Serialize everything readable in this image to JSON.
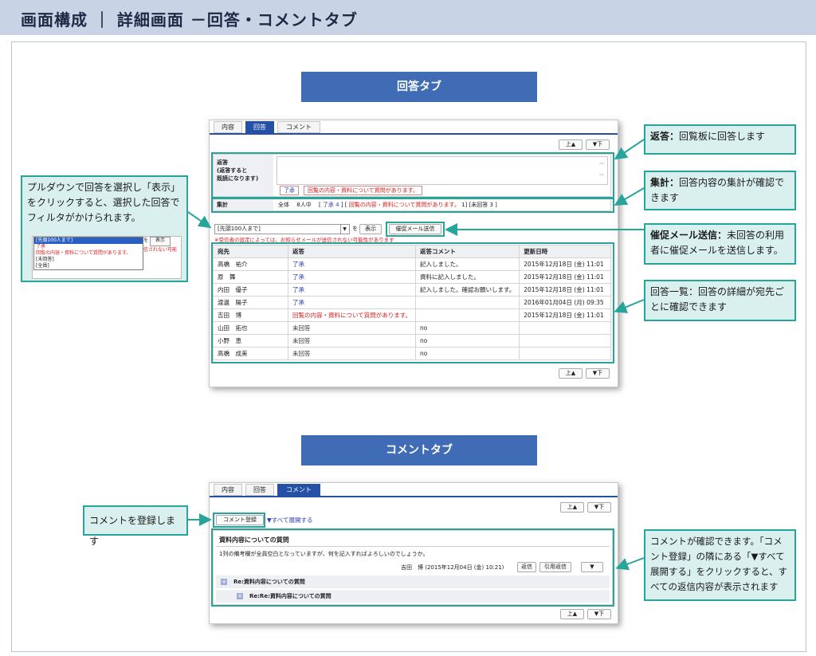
{
  "header": {
    "title": "画面構成 ｜ 詳細画面 －回答・コメントタブ"
  },
  "banners": {
    "answer": "回答タブ",
    "comment": "コメントタブ"
  },
  "answer_tab": {
    "tabs": [
      "内容",
      "回答",
      "コメント"
    ],
    "active_tab": "回答",
    "up_btn": "上▲",
    "down_btn": "▼下",
    "reply_label": "返答\n(返答すると\n既読になります)",
    "reply_options": [
      "了承",
      "回覧の内容・資料について質問があります。"
    ],
    "summary_label": "集計",
    "summary_scope": "全体",
    "summary_count": "8人中",
    "summary_prefix": "[",
    "summary_ack": "了承 4",
    "summary_mid": "] [",
    "summary_question": "回覧の内容・資料について質問があります。",
    "summary_question_count": "1] [未回答 3 ]",
    "filter_select": "[先頭100人まで]",
    "filter_wo": "を",
    "show_btn": "表示",
    "reminder_btn": "催促メール送信",
    "notice": "※受信者の設定によっては、お知らせメールが送信されない可能性があります",
    "columns": [
      "宛先",
      "返答",
      "返答コメント",
      "更新日時"
    ],
    "rows": [
      {
        "to": "高橋　祐介",
        "reply": "了承",
        "color": "#2a3fc0",
        "comment": "記入しました。",
        "date": "2015年12月18日 (金) 11:01"
      },
      {
        "to": "原　舞",
        "reply": "了承",
        "color": "#2a3fc0",
        "comment": "資料に記入しました。",
        "date": "2015年12月18日 (金) 11:01"
      },
      {
        "to": "内田　優子",
        "reply": "了承",
        "color": "#2a3fc0",
        "comment": "記入しました。確認お願いします。",
        "date": "2015年12月18日 (金) 11:01"
      },
      {
        "to": "渡邊　陽子",
        "reply": "了承",
        "color": "#2a3fc0",
        "comment": "",
        "date": "2016年01月04日 (月) 09:35"
      },
      {
        "to": "吉田　博",
        "reply": "回覧の内容・資料について質問があります。",
        "color": "#d62020",
        "comment": "",
        "date": "2015年12月18日 (金) 11:01"
      },
      {
        "to": "山田　拓也",
        "reply": "未回答",
        "color": "#333333",
        "comment": "no",
        "date": ""
      },
      {
        "to": "小野　恵",
        "reply": "未回答",
        "color": "#333333",
        "comment": "no",
        "date": ""
      },
      {
        "to": "高橋　成美",
        "reply": "未回答",
        "color": "#333333",
        "comment": "no",
        "date": ""
      }
    ]
  },
  "dropdown_example": {
    "options": [
      "[先頭100人まで]",
      "了承",
      "回覧の内容・資料について質問があります。",
      "[未回答]",
      "[全員]"
    ],
    "side_btn": "表示",
    "side_wo": "を",
    "side_red": "信されない可能"
  },
  "callouts": {
    "filter": "プルダウンで回答を選択し「表示」をクリックすると、選択した回答でフィルタがかけられます。",
    "reply_title": "返答：",
    "reply_text": "回覧板に回答します",
    "summary_title": "集計：",
    "summary_text": "回答内容の集計が確認できます",
    "reminder_title": "催促メール送信：",
    "reminder_text": "未回答の利用者に催促メールを送信します。",
    "list_text": "回答一覧：回答の詳細が宛先ごとに確認できます",
    "register_text": "コメントを登録します",
    "comment_text": "コメントが確認できます。「コメント登録」の隣にある「▼すべて展開する」をクリックすると、すべての返信内容が表示されます"
  },
  "comment_tab": {
    "tabs": [
      "内容",
      "回答",
      "コメント"
    ],
    "active_tab": "コメント",
    "up_btn": "上▲",
    "down_btn": "▼下",
    "register_btn": "コメント登録",
    "expand_link": "▼すべて展開する",
    "thread_title": "資料内容についての質問",
    "thread_body": "1列の備考欄が全員空白となっていますが、何を記入すればよろしいのでしょうか。",
    "thread_meta": "吉田　博 (2015年12月04日 (金) 10:21)",
    "reply_btn": "返信",
    "quote_btn": "引用返信",
    "menu_btn": "▼",
    "reply1": "Re:資料内容についての質問",
    "reply2": "Re:Re:資料内容についての質問"
  },
  "colors": {
    "accent": "#2450a5",
    "banner": "#3f6cb5",
    "callout_border": "#28a59a",
    "callout_fill": "#d9f0ee"
  }
}
